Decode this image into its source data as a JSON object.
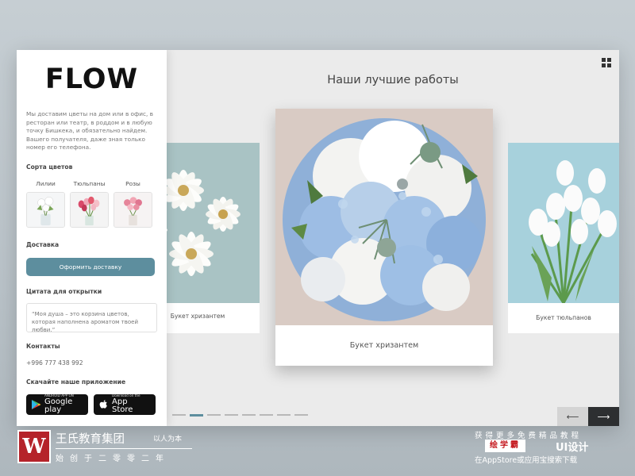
{
  "sidebar": {
    "logo": "FLOW",
    "about": "Мы доставим цветы на дом или в офис, в ресторан или театр, в роддом и в любую точку Бишкека, и обязательно найдем. Вашего получателя, даже зная только номер его телефона.",
    "kinds_title": "Сорта цветов",
    "kinds": [
      {
        "label": "Лилии"
      },
      {
        "label": "Тюльпаны"
      },
      {
        "label": "Розы"
      }
    ],
    "delivery_title": "Доставка",
    "delivery_button": "Оформить доставку",
    "quote_title": "Цитата для открытки",
    "quote_text": "“Моя душа – это корзина цветов, которая наполнена ароматом твоей любви.”",
    "contacts_title": "Контакты",
    "phone": "+996 777 438 992",
    "app_title": "Скачайте наше приложение",
    "google_small": "ANDROID APP ON",
    "google_big": "Google play",
    "apple_small": "Download on the",
    "apple_big": "App Store"
  },
  "main": {
    "title": "Наши лучшие работы",
    "cards": [
      {
        "caption": "Букет хризантем"
      },
      {
        "caption": "Букет хризантем"
      },
      {
        "caption": "Букет тюльпанов"
      }
    ],
    "slides_count": 8,
    "active_slide": 1,
    "prev_label": "⟵",
    "next_label": "⟶"
  },
  "watermark": {
    "logo_letter": "W",
    "cn_title": "王氏教育集团",
    "cn_sub": "以人为本",
    "cn_motto": "始创于二零零二年",
    "right_line1": "获得更多免费精品教程",
    "right_brand": "绘学霸",
    "right_ui": "UI设计",
    "right_line3": "在AppStore或应用宝搜索下载"
  },
  "colors": {
    "accent": "#5d8e9e",
    "next_button": "#2d2f31",
    "prev_button": "#d4d4d4"
  }
}
